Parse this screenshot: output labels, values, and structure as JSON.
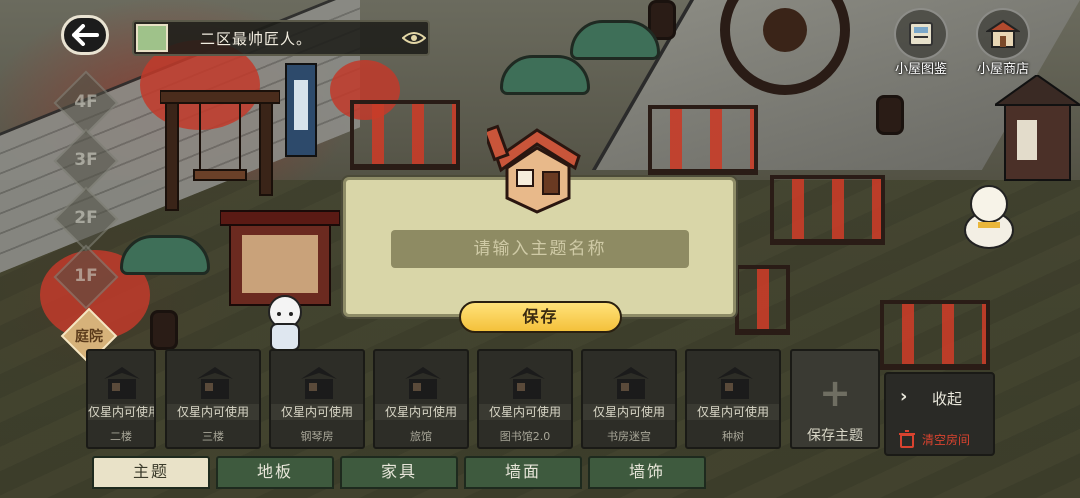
{
  "header": {
    "player_name": "二区最帅匠人。"
  },
  "floors": [
    "4F",
    "3F",
    "2F",
    "1F"
  ],
  "yard_label": "庭院",
  "top_right": [
    {
      "label": "小屋图鉴",
      "icon": "book-icon"
    },
    {
      "label": "小屋商店",
      "icon": "shop-icon"
    }
  ],
  "dialog": {
    "placeholder": "请输入主题名称",
    "save_label": "保存"
  },
  "theme_cards": [
    {
      "tag": "仅星内可使用",
      "name": "二楼"
    },
    {
      "tag": "仅星内可使用",
      "name": "三楼"
    },
    {
      "tag": "仅星内可使用",
      "name": "钢琴房"
    },
    {
      "tag": "仅星内可使用",
      "name": "旅馆"
    },
    {
      "tag": "仅星内可使用",
      "name": "图书馆2.0"
    },
    {
      "tag": "仅星内可使用",
      "name": "书房迷宫"
    },
    {
      "tag": "仅星内可使用",
      "name": "种树"
    }
  ],
  "add_theme_label": "保存主题",
  "side": {
    "collapse_label": "收起",
    "clear_label": "清空房间"
  },
  "tabs": [
    "主题",
    "地板",
    "家具",
    "墙面",
    "墙饰"
  ],
  "colors": {
    "accent_yellow": "#f4c13b",
    "dialog_bg": "#d9d6a8",
    "tab_green": "#3e5a3e",
    "danger_red": "#d9432f"
  }
}
